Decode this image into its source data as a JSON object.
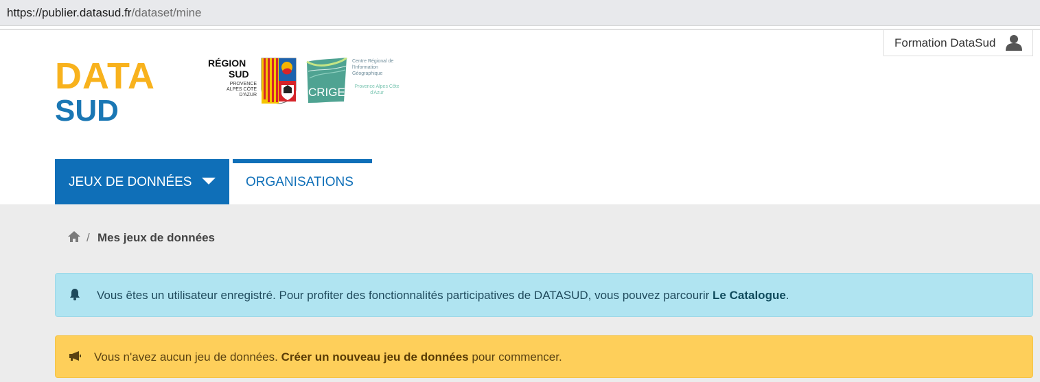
{
  "browser": {
    "url_host": "https://publier.datasud.fr",
    "url_path": "/dataset/mine"
  },
  "account": {
    "user_name": "Formation DataSud",
    "icon": "user-icon"
  },
  "logos": {
    "datasud_line1": "DATA",
    "datasud_line2": "SUD",
    "region_line1": "RÉGION",
    "region_line2": "SUD",
    "region_sub": "PROVENCE ALPES CÔTE D'AZUR",
    "crige_name": "CRIGE",
    "crige_desc": "Centre Régional de l'Information Géographique",
    "crige_region": "Provence Alpes Côte d'Azur"
  },
  "nav": {
    "tab_datasets": "JEUX DE DONNÉES",
    "tab_organisations": "ORGANISATIONS"
  },
  "breadcrumb": {
    "separator": "/",
    "current": "Mes jeux de données"
  },
  "alerts": {
    "info_text": "Vous êtes un utilisateur enregistré. Pour profiter des fonctionnalités participatives de DATASUD, vous pouvez parcourir ",
    "info_link": "Le Catalogue",
    "info_end": ".",
    "warn_text": "Vous n'avez aucun jeu de données. ",
    "warn_link": "Créer un nouveau jeu de données",
    "warn_end": " pour commencer."
  },
  "colors": {
    "primary": "#0f6fb8",
    "datasud_yellow": "#f8b21d",
    "datasud_blue": "#1a77b4",
    "info_bg": "#b0e4f1",
    "warning_bg": "#fecf5a",
    "content_bg": "#ececec"
  }
}
